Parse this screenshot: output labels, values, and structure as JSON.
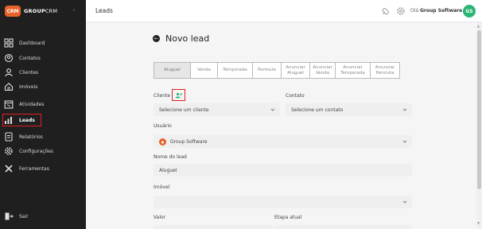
{
  "brand": {
    "logo_text": "CRM",
    "name_bold": "GROUP",
    "name_light": "CRM"
  },
  "sidebar": {
    "items": [
      {
        "label": "Dashboard",
        "icon": "dashboard-icon"
      },
      {
        "label": "Contatos",
        "icon": "contacts-icon"
      },
      {
        "label": "Clientes",
        "icon": "person-icon"
      },
      {
        "label": "Imóveis",
        "icon": "home-icon"
      },
      {
        "label": "Atividades",
        "icon": "calendar-icon"
      },
      {
        "label": "Leads",
        "icon": "chart-icon",
        "active": true
      },
      {
        "label": "Relatórios",
        "icon": "report-icon"
      },
      {
        "label": "Configurações",
        "icon": "gear-icon"
      },
      {
        "label": "Ferramentas",
        "icon": "tools-icon"
      }
    ],
    "logout_label": "Sair"
  },
  "header": {
    "title": "Leads",
    "greeting_prefix": "Olá",
    "greeting_name": "Group Software",
    "avatar_initials": "GS"
  },
  "page": {
    "title": "Novo lead"
  },
  "tabs": [
    {
      "label": "Aluguel",
      "active": true
    },
    {
      "label": "Venda"
    },
    {
      "label": "Temporada"
    },
    {
      "label": "Permuta"
    },
    {
      "label": "Anunciar Aluguel"
    },
    {
      "label": "Anunciar Venda"
    },
    {
      "label": "Anunciar Temporada"
    },
    {
      "label": "Anunciar Permuta"
    }
  ],
  "form": {
    "cliente_label": "Cliente",
    "cliente_value": "Selecione um cliente",
    "contato_label": "Contato",
    "contato_value": "Selecione um contato",
    "usuario_label": "Usuário",
    "usuario_value": "Group Software",
    "nome_label": "Nome do lead",
    "nome_value": "Aluguel",
    "imovel_label": "Imóvel",
    "imovel_value": "",
    "valor_label": "Valor",
    "etapa_label": "Etapa atual"
  },
  "colors": {
    "accent": "#e8622a",
    "avatar": "#2bb573",
    "highlight": "#e02020",
    "sidebar_bg": "#1f1f1f"
  }
}
